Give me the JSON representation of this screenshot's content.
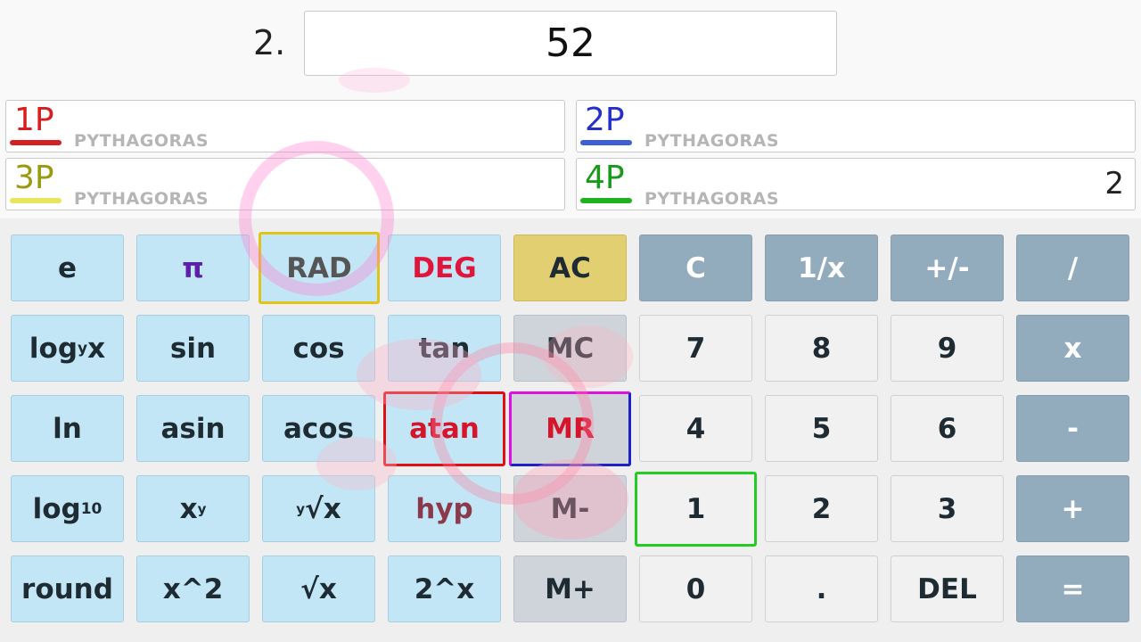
{
  "question": {
    "number": "2.",
    "answer": "52"
  },
  "players": [
    {
      "label": "1P",
      "mode": "PYTHAGORAS",
      "score": "",
      "color": "#d42020",
      "bar_color": "#d42020"
    },
    {
      "label": "2P",
      "mode": "PYTHAGORAS",
      "score": "",
      "color": "#2530c8",
      "bar_color": "#3a5fd6"
    },
    {
      "label": "3P",
      "mode": "PYTHAGORAS",
      "score": "",
      "color": "#9a9a10",
      "bar_color": "#e8e65a"
    },
    {
      "label": "4P",
      "mode": "PYTHAGORAS",
      "score": "2",
      "color": "#1a9a1a",
      "bar_color": "#1fb21f"
    }
  ],
  "keys": {
    "r1": [
      "e",
      "π",
      "RAD",
      "DEG",
      "AC",
      "C",
      "1/x",
      "+/-",
      "/"
    ],
    "r2": [
      "log",
      "y",
      "x",
      "sin",
      "cos",
      "tan",
      "MC",
      "7",
      "8",
      "9",
      "x"
    ],
    "r3": [
      "ln",
      "asin",
      "acos",
      "atan",
      "MR",
      "4",
      "5",
      "6",
      "-"
    ],
    "r4": [
      "log",
      "10",
      "x",
      "y",
      "y",
      "√x",
      "hyp",
      "M-",
      "1",
      "2",
      "3",
      "+"
    ],
    "r5": [
      "round",
      "x^2",
      "√x",
      "2^x",
      "M+",
      "0",
      ".",
      "DEL",
      "="
    ]
  },
  "colors": {
    "pi": "#5b1fa8",
    "rad_text": "#555555",
    "deg_text": "#e0153b",
    "rad_border": "#e2c317",
    "atan_border": "#e01010",
    "mr_border_left": "#e010e0",
    "mr_border_right": "#1a22c8",
    "one_border": "#22cc22"
  }
}
